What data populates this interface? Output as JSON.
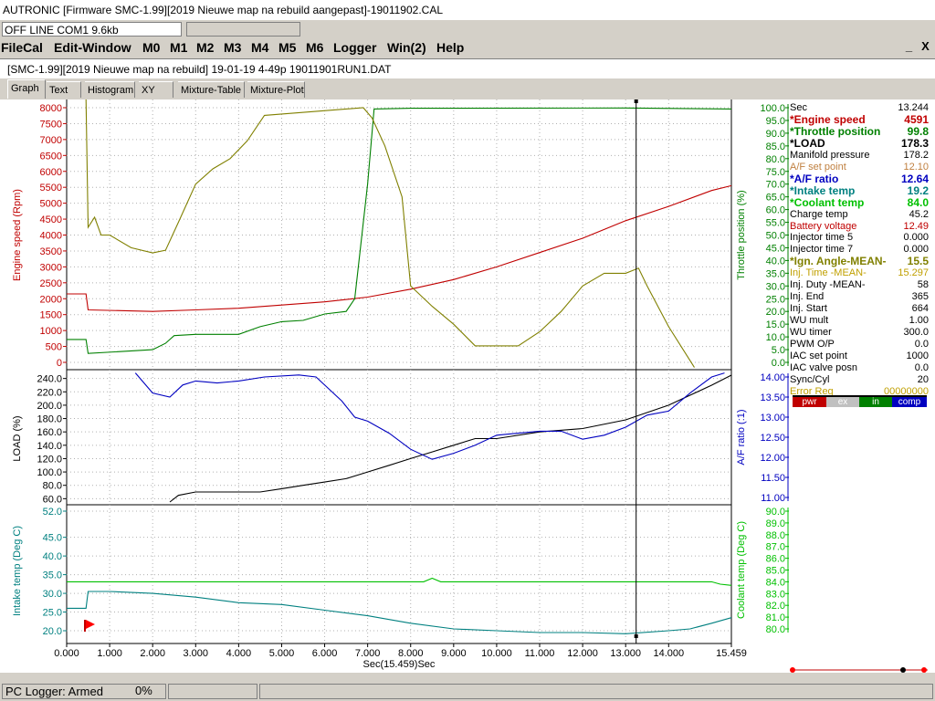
{
  "window": {
    "title": "AUTRONIC [Firmware SMC-1.99][2019 Nieuwe map na rebuild aangepast]-19011902.CAL",
    "connection_status": "OFF LINE COM1 9.6kb"
  },
  "menu": {
    "items": [
      "FileCal",
      "Edit-Window",
      "M0",
      "M1",
      "M2",
      "M3",
      "M4",
      "M5",
      "M6",
      "Logger",
      "Win(2)",
      "Help"
    ],
    "minimize": "_",
    "close": "X"
  },
  "child_window": {
    "title": "[SMC-1.99][2019 Nieuwe map na rebuild] 19-01-19 4-49p 19011901RUN1.DAT"
  },
  "tabs": [
    "Graph",
    "Text",
    "Histogram",
    "XY",
    "Mixture-Table",
    "Mixture-Plot"
  ],
  "active_tab": "Graph",
  "readout": [
    {
      "label": "Sec",
      "value": "13.244",
      "color": "#000000",
      "bold": false
    },
    {
      "label": "*Engine speed",
      "value": "4591",
      "color": "#c00000",
      "bold": true
    },
    {
      "label": "*Throttle position",
      "value": "99.8",
      "color": "#008000",
      "bold": true
    },
    {
      "label": "*LOAD",
      "value": "178.3",
      "color": "#000000",
      "bold": true
    },
    {
      "label": "Manifold pressure",
      "value": "178.2",
      "color": "#000000",
      "bold": false
    },
    {
      "label": "A/F set point",
      "value": "12.10",
      "color": "#c08040",
      "bold": false
    },
    {
      "label": "*A/F ratio",
      "value": "12.64",
      "color": "#0000c0",
      "bold": true
    },
    {
      "label": "*Intake temp",
      "value": "19.2",
      "color": "#008080",
      "bold": true
    },
    {
      "label": "*Coolant temp",
      "value": "84.0",
      "color": "#00c000",
      "bold": true
    },
    {
      "label": "Charge temp",
      "value": "45.2",
      "color": "#000000",
      "bold": false
    },
    {
      "label": "Battery voltage",
      "value": "12.49",
      "color": "#c00000",
      "bold": false
    },
    {
      "label": "Injector time 5",
      "value": "0.000",
      "color": "#000000",
      "bold": false
    },
    {
      "label": "Injector time 7",
      "value": "0.000",
      "color": "#000000",
      "bold": false
    },
    {
      "label": "*Ign. Angle-MEAN-",
      "value": "15.5",
      "color": "#808000",
      "bold": true
    },
    {
      "label": "Inj. Time -MEAN-",
      "value": "15.297",
      "color": "#c0a000",
      "bold": false
    },
    {
      "label": "Inj. Duty -MEAN-",
      "value": "58",
      "color": "#000000",
      "bold": false
    },
    {
      "label": "Inj. End",
      "value": "365",
      "color": "#000000",
      "bold": false
    },
    {
      "label": "Inj. Start",
      "value": "664",
      "color": "#000000",
      "bold": false
    },
    {
      "label": "WU mult",
      "value": "1.00",
      "color": "#000000",
      "bold": false
    },
    {
      "label": "WU timer",
      "value": "300.0",
      "color": "#000000",
      "bold": false
    },
    {
      "label": "PWM O/P",
      "value": "0.0",
      "color": "#000000",
      "bold": false
    },
    {
      "label": "IAC set point",
      "value": "1000",
      "color": "#000000",
      "bold": false
    },
    {
      "label": "IAC valve posn",
      "value": "0.0",
      "color": "#000000",
      "bold": false
    },
    {
      "label": "Sync/Cyl",
      "value": "20",
      "color": "#000000",
      "bold": false
    },
    {
      "label": "Error Reg",
      "value": "00000000",
      "color": "#c0a000",
      "bold": false
    }
  ],
  "indicators": [
    {
      "label": "pwr",
      "bg": "#c00000"
    },
    {
      "label": "ex",
      "bg": "#c0c0c0"
    },
    {
      "label": "in",
      "bg": "#008000"
    },
    {
      "label": "comp",
      "bg": "#0000c0"
    }
  ],
  "status_bar": {
    "logger": "PC Logger: Armed",
    "percent": "0%"
  },
  "chart_data": [
    {
      "type": "line",
      "title": "",
      "xlabel": "Sec(15.459)Sec",
      "x_ticks": [
        "0.000",
        "1.000",
        "2.000",
        "3.000",
        "4.000",
        "5.000",
        "6.000",
        "7.000",
        "8.000",
        "9.000",
        "10.000",
        "11.000",
        "12.000",
        "13.000",
        "14.000",
        "15.459"
      ],
      "xlim": [
        0,
        15.459
      ],
      "cursor_x": 13.244,
      "left_axis": {
        "label": "Engine speed (Rpm)",
        "color": "#c00000",
        "ylim": [
          0,
          8000
        ],
        "ticks": [
          "0",
          "500",
          "1000",
          "1500",
          "2000",
          "2500",
          "3000",
          "3500",
          "4000",
          "4500",
          "5000",
          "5500",
          "6000",
          "6500",
          "7000",
          "7500",
          "8000"
        ]
      },
      "right_axis": {
        "label": "Throttle position (%)",
        "color": "#008000",
        "ylim": [
          0,
          100
        ],
        "ticks": [
          "0.0",
          "5.0",
          "10.0",
          "15.0",
          "20.0",
          "25.0",
          "30.0",
          "35.0",
          "40.0",
          "45.0",
          "50.0",
          "55.0",
          "60.0",
          "65.0",
          "70.0",
          "75.0",
          "80.0",
          "85.0",
          "90.0",
          "95.0",
          "100.0"
        ]
      },
      "series": [
        {
          "name": "Engine speed",
          "color": "#c00000",
          "axis": "left",
          "x": [
            0,
            0.45,
            0.5,
            2.0,
            3.0,
            4.0,
            5.0,
            6.0,
            7.0,
            8.0,
            9.0,
            10.0,
            11.0,
            12.0,
            13.0,
            14.0,
            15.0,
            15.459
          ],
          "y": [
            2150,
            2150,
            1650,
            1600,
            1650,
            1700,
            1800,
            1900,
            2050,
            2300,
            2600,
            3000,
            3450,
            3900,
            4450,
            4900,
            5400,
            5550
          ]
        },
        {
          "name": "Throttle position",
          "color": "#008000",
          "axis": "right",
          "x": [
            0,
            0.45,
            0.5,
            2.0,
            2.3,
            2.5,
            3.0,
            4.0,
            4.5,
            5.0,
            5.5,
            6.0,
            6.5,
            6.7,
            7.0,
            7.15,
            8.0,
            13.0,
            15.459
          ],
          "y": [
            9,
            9,
            3.5,
            5,
            7.5,
            10.5,
            11,
            11,
            14,
            16,
            16.5,
            19,
            20,
            25,
            70,
            99.5,
            99.8,
            99.9,
            99.5
          ]
        },
        {
          "name": "Ign. Angle-MEAN-",
          "color": "#808000",
          "axis": "right",
          "x": [
            0.45,
            0.5,
            0.65,
            0.8,
            1.0,
            1.5,
            2.0,
            2.3,
            2.6,
            3.0,
            3.4,
            3.8,
            4.2,
            4.6,
            6.9,
            7.1,
            7.4,
            7.8,
            8.0,
            8.5,
            9.0,
            9.5,
            10.5,
            11.0,
            11.5,
            12.0,
            12.5,
            13.0,
            13.3,
            13.5,
            14.0,
            14.6
          ],
          "y": [
            110,
            53,
            57,
            50,
            50,
            45,
            43,
            44,
            55,
            70,
            76,
            80,
            87,
            97,
            100,
            96,
            85,
            65,
            30,
            22,
            15,
            6.5,
            6.5,
            12,
            20,
            30,
            35,
            35,
            37,
            30,
            14,
            -2
          ]
        }
      ]
    },
    {
      "type": "line",
      "title": "",
      "left_axis": {
        "label": "LOAD (%)",
        "color": "#000000",
        "ylim": [
          40,
          250
        ],
        "ticks": [
          "60.0",
          "80.0",
          "100.0",
          "120.0",
          "140.0",
          "160.0",
          "180.0",
          "200.0",
          "220.0",
          "240.0"
        ]
      },
      "right_axis": {
        "label": "A/F ratio (:1)",
        "color": "#0000c0",
        "ylim": [
          10.75,
          14.25
        ],
        "ticks": [
          "11.00",
          "11.50",
          "12.00",
          "12.50",
          "13.00",
          "13.50",
          "14.00"
        ]
      },
      "series": [
        {
          "name": "LOAD",
          "color": "#000000",
          "axis": "left",
          "x": [
            2.4,
            2.6,
            3.0,
            3.5,
            4.0,
            4.5,
            5.0,
            5.5,
            6.0,
            6.5,
            7.0,
            7.5,
            8.0,
            8.5,
            9.0,
            9.5,
            10.0,
            11.0,
            12.0,
            13.0,
            14.0,
            15.0,
            15.459
          ],
          "y": [
            55,
            65,
            70,
            70,
            70,
            70,
            75,
            80,
            85,
            90,
            100,
            110,
            120,
            130,
            140,
            150,
            150,
            160,
            165,
            178,
            200,
            230,
            245
          ]
        },
        {
          "name": "A/F ratio",
          "color": "#0000c0",
          "axis": "right",
          "x": [
            1.6,
            2.0,
            2.4,
            2.7,
            3.0,
            3.5,
            4.0,
            4.6,
            5.4,
            5.8,
            6.4,
            6.7,
            7.0,
            7.5,
            8.0,
            8.5,
            9.0,
            9.5,
            10.0,
            10.5,
            11.0,
            11.5,
            12.0,
            12.5,
            13.0,
            13.5,
            14.0,
            14.5,
            15.0,
            15.3
          ],
          "y": [
            14.1,
            13.6,
            13.5,
            13.8,
            13.9,
            13.85,
            13.9,
            14.0,
            14.05,
            14.0,
            13.4,
            13.0,
            12.9,
            12.6,
            12.2,
            11.95,
            12.1,
            12.3,
            12.55,
            12.6,
            12.65,
            12.65,
            12.45,
            12.55,
            12.75,
            13.05,
            13.15,
            13.6,
            14.0,
            14.1
          ]
        }
      ]
    },
    {
      "type": "line",
      "title": "",
      "left_axis": {
        "label": "Intake temp (Deg C)",
        "color": "#008080",
        "ylim": [
          19,
          53
        ],
        "ticks": [
          "20.0",
          "25.0",
          "30.0",
          "35.0",
          "40.0",
          "45.0",
          "52.0"
        ]
      },
      "right_axis": {
        "label": "Coolant temp (Deg C)",
        "color": "#00c000",
        "ylim": [
          79.8,
          90.3
        ],
        "ticks": [
          "80.0",
          "81.0",
          "82.0",
          "83.0",
          "84.0",
          "85.0",
          "86.0",
          "87.0",
          "88.0",
          "89.0",
          "90.0"
        ]
      },
      "series": [
        {
          "name": "Intake temp",
          "color": "#008080",
          "axis": "left",
          "x": [
            0,
            0.45,
            0.5,
            1.0,
            2.0,
            3.0,
            4.0,
            5.0,
            6.0,
            7.0,
            8.0,
            9.0,
            10.0,
            11.0,
            12.0,
            13.0,
            14.0,
            14.5,
            15.0,
            15.459
          ],
          "y": [
            26,
            26,
            30.5,
            30.5,
            30,
            29,
            27.5,
            27,
            25.5,
            24,
            22,
            20.5,
            20,
            19.5,
            19.5,
            19.2,
            20,
            20.5,
            22,
            23.5
          ]
        },
        {
          "name": "Coolant temp",
          "color": "#00c000",
          "axis": "right",
          "x": [
            0,
            8.3,
            8.5,
            8.7,
            15.0,
            15.2,
            15.459
          ],
          "y": [
            84.0,
            84.0,
            84.3,
            84.0,
            84.0,
            83.8,
            83.7
          ]
        }
      ]
    }
  ]
}
